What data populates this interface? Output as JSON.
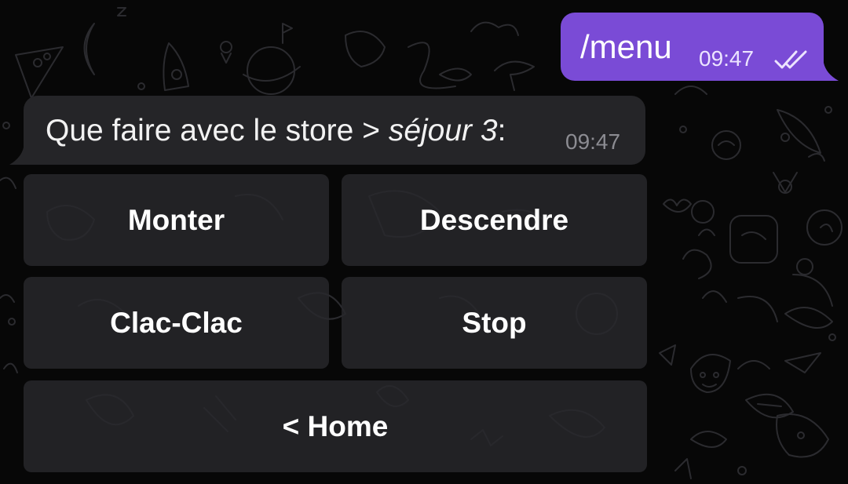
{
  "outgoing_message": {
    "text": "/menu",
    "time": "09:47",
    "status_icon": "double-check-icon",
    "bubble_color": "#7a4bd6"
  },
  "incoming_message": {
    "text_before": "Que faire avec le store > ",
    "text_italic": "séjour 3",
    "text_after": ":",
    "time": "09:47",
    "bubble_color": "#252528"
  },
  "keyboard": {
    "monter": "Monter",
    "descendre": "Descendre",
    "clac_clac": "Clac-Clac",
    "stop": "Stop",
    "home": "< Home",
    "button_color": "#28282c"
  },
  "background": {
    "color": "#070707",
    "pattern_icon": "doodle-wallpaper-pattern"
  }
}
